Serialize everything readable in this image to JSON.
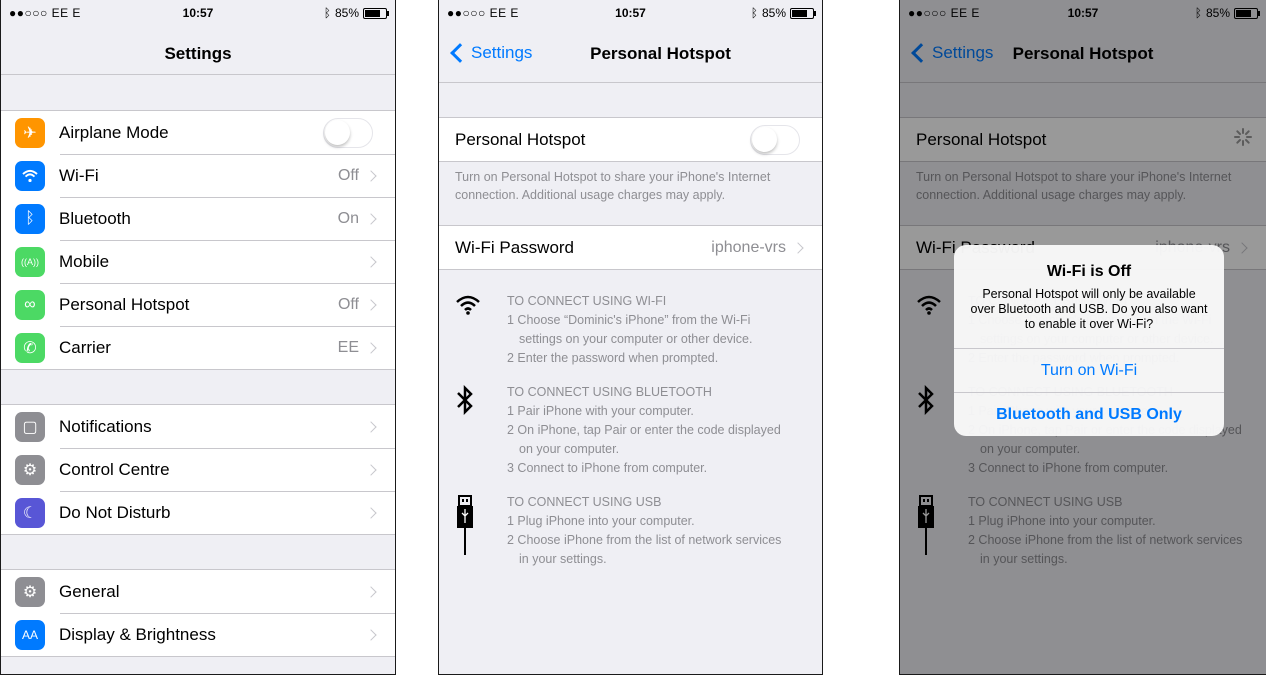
{
  "status": {
    "carrier": "●●○○○ EE  E",
    "time": "10:57",
    "battery": "85%",
    "battery_level": 0.85
  },
  "panel1": {
    "title": "Settings",
    "groups": [
      [
        {
          "label": "Airplane Mode",
          "icon": "airplane-icon",
          "color": "#ff9500",
          "glyph": "✈",
          "accessory": "toggle",
          "value": ""
        },
        {
          "label": "Wi-Fi",
          "icon": "wifi-icon",
          "color": "#007aff",
          "glyph": "wifi",
          "accessory": "chevron",
          "value": "Off"
        },
        {
          "label": "Bluetooth",
          "icon": "bluetooth-icon",
          "color": "#007aff",
          "glyph": "ᛒ",
          "accessory": "chevron",
          "value": "On"
        },
        {
          "label": "Mobile",
          "icon": "antenna-icon",
          "color": "#4cd964",
          "glyph": "((A))",
          "accessory": "chevron",
          "value": ""
        },
        {
          "label": "Personal Hotspot",
          "icon": "hotspot-icon",
          "color": "#4cd964",
          "glyph": "∞",
          "accessory": "chevron",
          "value": "Off"
        },
        {
          "label": "Carrier",
          "icon": "phone-icon",
          "color": "#4cd964",
          "glyph": "✆",
          "accessory": "chevron",
          "value": "EE"
        }
      ],
      [
        {
          "label": "Notifications",
          "icon": "notifications-icon",
          "color": "#8e8e93",
          "glyph": "▢",
          "accessory": "chevron",
          "value": ""
        },
        {
          "label": "Control Centre",
          "icon": "control-centre-icon",
          "color": "#8e8e93",
          "glyph": "⚙",
          "accessory": "chevron",
          "value": ""
        },
        {
          "label": "Do Not Disturb",
          "icon": "moon-icon",
          "color": "#5856d6",
          "glyph": "☾",
          "accessory": "chevron",
          "value": ""
        }
      ],
      [
        {
          "label": "General",
          "icon": "gear-icon",
          "color": "#8e8e93",
          "glyph": "⚙",
          "accessory": "chevron",
          "value": ""
        },
        {
          "label": "Display & Brightness",
          "icon": "display-icon",
          "color": "#007aff",
          "glyph": "AA",
          "accessory": "chevron",
          "value": ""
        }
      ]
    ]
  },
  "hotspot": {
    "back": "Settings",
    "title": "Personal Hotspot",
    "toggle_label": "Personal Hotspot",
    "footer": "Turn on Personal Hotspot to share your iPhone's Internet connection. Additional usage charges may apply.",
    "password_label": "Wi-Fi Password",
    "password_value": "iphone-vrs",
    "wifi": {
      "heading": "TO CONNECT USING WI-FI",
      "l1": "1 Choose “Dominic's iPhone” from the Wi-Fi",
      "l1b": "settings on your computer or other device.",
      "l2": "2 Enter the password when prompted."
    },
    "bt": {
      "heading": "TO CONNECT USING BLUETOOTH",
      "l1": "1 Pair iPhone with your computer.",
      "l2": "2 On iPhone, tap Pair or enter the code displayed",
      "l2b": "on your computer.",
      "l3": "3 Connect to iPhone from computer."
    },
    "usb": {
      "heading": "TO CONNECT USING USB",
      "l1": "1 Plug iPhone into your computer.",
      "l2": "2 Choose iPhone from the list of network services",
      "l2b": "in your settings."
    }
  },
  "alert": {
    "title": "Wi-Fi is Off",
    "message": "Personal Hotspot will only be available over Bluetooth and USB. Do you also want to enable it over Wi-Fi?",
    "btn_wifi": "Turn on Wi-Fi",
    "btn_bt": "Bluetooth and USB Only"
  }
}
